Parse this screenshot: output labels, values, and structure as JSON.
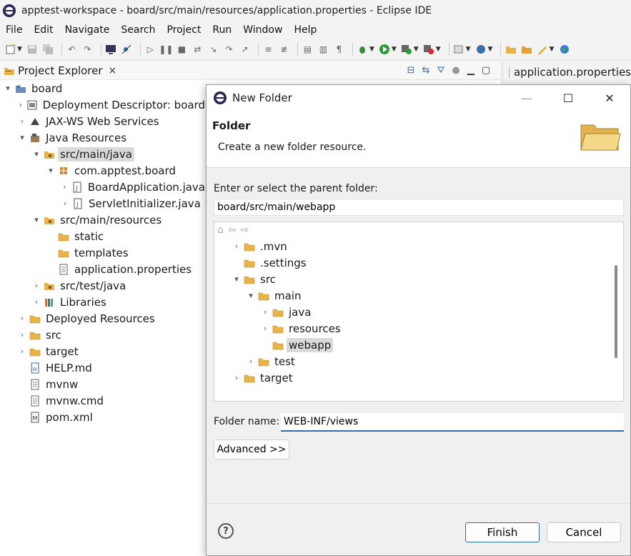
{
  "window": {
    "title": "apptest-workspace - board/src/main/resources/application.properties - Eclipse IDE"
  },
  "menu": [
    "File",
    "Edit",
    "Navigate",
    "Search",
    "Project",
    "Run",
    "Window",
    "Help"
  ],
  "explorer": {
    "title": "Project Explorer",
    "close": "×",
    "tree": [
      {
        "label": "board",
        "arrow": "▾",
        "icon": "project-icon",
        "indent": 0
      },
      {
        "label": "Deployment Descriptor: board",
        "arrow": "›",
        "icon": "deployment-descriptor-icon",
        "indent": 1
      },
      {
        "label": "JAX-WS Web Services",
        "arrow": "›",
        "icon": "web-services-icon",
        "indent": 1
      },
      {
        "label": "Java Resources",
        "arrow": "▾",
        "icon": "java-resources-icon",
        "indent": 1
      },
      {
        "label": "src/main/java",
        "arrow": "▾",
        "icon": "source-folder-icon",
        "indent": 2,
        "selected": true
      },
      {
        "label": "com.apptest.board",
        "arrow": "▾",
        "icon": "package-icon",
        "indent": 3
      },
      {
        "label": "BoardApplication.java",
        "arrow": "›",
        "icon": "java-file-icon",
        "indent": 4
      },
      {
        "label": "ServletInitializer.java",
        "arrow": "›",
        "icon": "java-file-icon",
        "indent": 4
      },
      {
        "label": "src/main/resources",
        "arrow": "▾",
        "icon": "source-folder-icon",
        "indent": 2
      },
      {
        "label": "static",
        "arrow": "",
        "icon": "folder-icon",
        "indent": 3
      },
      {
        "label": "templates",
        "arrow": "",
        "icon": "folder-icon",
        "indent": 3
      },
      {
        "label": "application.properties",
        "arrow": "",
        "icon": "text-file-icon",
        "indent": 3
      },
      {
        "label": "src/test/java",
        "arrow": "›",
        "icon": "source-folder-icon",
        "indent": 2
      },
      {
        "label": "Libraries",
        "arrow": "›",
        "icon": "libraries-icon",
        "indent": 2
      },
      {
        "label": "Deployed Resources",
        "arrow": "›",
        "icon": "folder-icon",
        "indent": 1
      },
      {
        "label": "src",
        "arrow": "›",
        "icon": "folder-icon",
        "indent": 1
      },
      {
        "label": "target",
        "arrow": "›",
        "icon": "folder-icon",
        "indent": 1
      },
      {
        "label": "HELP.md",
        "arrow": "",
        "icon": "markdown-file-icon",
        "indent": 1
      },
      {
        "label": "mvnw",
        "arrow": "",
        "icon": "text-file-icon",
        "indent": 1
      },
      {
        "label": "mvnw.cmd",
        "arrow": "",
        "icon": "text-file-icon",
        "indent": 1
      },
      {
        "label": "pom.xml",
        "arrow": "",
        "icon": "maven-file-icon",
        "indent": 1
      }
    ]
  },
  "editor_tab": {
    "label": "application.properties"
  },
  "dialog": {
    "title": "New Folder",
    "heading": "Folder",
    "description": "Create a new folder resource.",
    "parent_label": "Enter or select the parent folder:",
    "parent_value": "board/src/main/webapp",
    "tree": [
      {
        "label": ".mvn",
        "arrow": "›",
        "indent": 1
      },
      {
        "label": ".settings",
        "arrow": "",
        "indent": 1
      },
      {
        "label": "src",
        "arrow": "▾",
        "indent": 1
      },
      {
        "label": "main",
        "arrow": "▾",
        "indent": 2
      },
      {
        "label": "java",
        "arrow": "›",
        "indent": 3
      },
      {
        "label": "resources",
        "arrow": "›",
        "indent": 3
      },
      {
        "label": "webapp",
        "arrow": "",
        "indent": 3,
        "selected": true
      },
      {
        "label": "test",
        "arrow": "›",
        "indent": 2
      },
      {
        "label": "target",
        "arrow": "›",
        "indent": 1
      }
    ],
    "folder_name_label": "Folder name:",
    "folder_name_value": "WEB-INF/views",
    "advanced_label": "Advanced >>",
    "help_label": "?",
    "finish_label": "Finish",
    "cancel_label": "Cancel",
    "minimize": "—",
    "maximize": "☐",
    "close": "✕"
  },
  "colors": {
    "accent": "#2e6fb0",
    "folder": "#e8b44a",
    "selection": "#dadada"
  }
}
